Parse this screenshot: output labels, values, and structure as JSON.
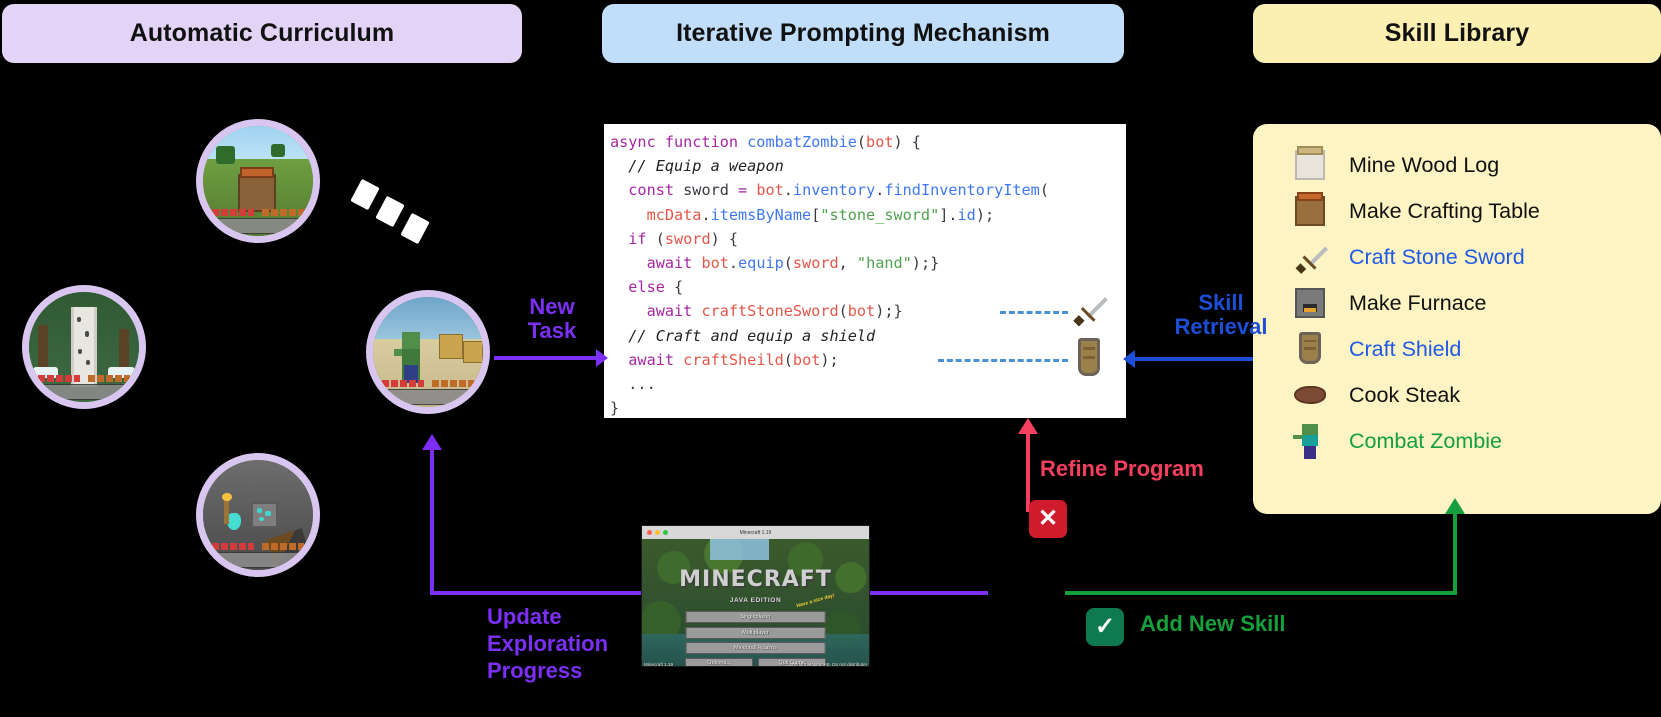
{
  "headers": {
    "curriculum": {
      "label": "Automatic Curriculum",
      "color": "#e3d4f7"
    },
    "prompting": {
      "label": "Iterative Prompting Mechanism",
      "color": "#c0ddf9"
    },
    "skill": {
      "label": "Skill Library",
      "color": "#fbf0b2"
    }
  },
  "code": {
    "lines": [
      [
        {
          "t": "async function ",
          "c": "k-kw"
        },
        {
          "t": "combatZombie",
          "c": "k-fn"
        },
        {
          "t": "(",
          "c": "k-pl"
        },
        {
          "t": "bot",
          "c": "k-var"
        },
        {
          "t": ") {",
          "c": "k-pl"
        }
      ],
      [
        {
          "t": "  // Equip a weapon",
          "c": "k-com"
        }
      ],
      [
        {
          "t": "  const",
          "c": "k-kw"
        },
        {
          "t": " sword ",
          "c": "k-pl"
        },
        {
          "t": "=",
          "c": "k-kw"
        },
        {
          "t": " bot",
          "c": "k-var"
        },
        {
          "t": ".",
          "c": "k-pl"
        },
        {
          "t": "inventory",
          "c": "k-prop"
        },
        {
          "t": ".",
          "c": "k-pl"
        },
        {
          "t": "findInventoryItem",
          "c": "k-prop"
        },
        {
          "t": "(",
          "c": "k-pl"
        }
      ],
      [
        {
          "t": "    mcData",
          "c": "k-var"
        },
        {
          "t": ".",
          "c": "k-pl"
        },
        {
          "t": "itemsByName",
          "c": "k-prop"
        },
        {
          "t": "[",
          "c": "k-pl"
        },
        {
          "t": "\"stone_sword\"",
          "c": "k-str"
        },
        {
          "t": "].",
          "c": "k-pl"
        },
        {
          "t": "id",
          "c": "k-prop"
        },
        {
          "t": ");",
          "c": "k-pl"
        }
      ],
      [
        {
          "t": "  if",
          "c": "k-kw"
        },
        {
          "t": " (",
          "c": "k-pl"
        },
        {
          "t": "sword",
          "c": "k-var"
        },
        {
          "t": ") {",
          "c": "k-pl"
        }
      ],
      [
        {
          "t": "    await",
          "c": "k-kw"
        },
        {
          "t": " bot",
          "c": "k-var"
        },
        {
          "t": ".",
          "c": "k-pl"
        },
        {
          "t": "equip",
          "c": "k-prop"
        },
        {
          "t": "(",
          "c": "k-pl"
        },
        {
          "t": "sword",
          "c": "k-var"
        },
        {
          "t": ", ",
          "c": "k-pl"
        },
        {
          "t": "\"hand\"",
          "c": "k-str"
        },
        {
          "t": ");}",
          "c": "k-pl"
        }
      ],
      [
        {
          "t": "  else",
          "c": "k-kw"
        },
        {
          "t": " {",
          "c": "k-pl"
        }
      ],
      [
        {
          "t": "    await",
          "c": "k-kw"
        },
        {
          "t": " ",
          "c": "k-pl"
        },
        {
          "t": "craftStoneSword",
          "c": "k-fn2"
        },
        {
          "t": "(",
          "c": "k-pl"
        },
        {
          "t": "bot",
          "c": "k-var"
        },
        {
          "t": ");}",
          "c": "k-pl"
        }
      ],
      [
        {
          "t": "  // Craft and equip a shield",
          "c": "k-com"
        }
      ],
      [
        {
          "t": "  await",
          "c": "k-kw"
        },
        {
          "t": " ",
          "c": "k-pl"
        },
        {
          "t": "craftSheild",
          "c": "k-fn2"
        },
        {
          "t": "(",
          "c": "k-pl"
        },
        {
          "t": "bot",
          "c": "k-var"
        },
        {
          "t": ");",
          "c": "k-pl"
        }
      ],
      [
        {
          "t": "  ...",
          "c": "k-pl"
        }
      ],
      [
        {
          "t": "}",
          "c": "k-pl"
        }
      ]
    ]
  },
  "skills": [
    {
      "icon": "wood-log-icon",
      "label": "Mine Wood  Log",
      "style": ""
    },
    {
      "icon": "crafting-table-icon",
      "label": "Make Crafting Table",
      "style": ""
    },
    {
      "icon": "stone-sword-icon",
      "label": "Craft Stone Sword",
      "style": "blue"
    },
    {
      "icon": "furnace-icon",
      "label": "Make Furnace",
      "style": ""
    },
    {
      "icon": "shield-icon",
      "label": "Craft Shield",
      "style": "blue"
    },
    {
      "icon": "steak-icon",
      "label": "Cook Steak",
      "style": ""
    },
    {
      "icon": "zombie-icon",
      "label": "Combat Zombie",
      "style": "green"
    }
  ],
  "arrows": {
    "new_task": {
      "label": "New\nTask",
      "line1": "New",
      "line2": "Task",
      "color": "#7b2ff7"
    },
    "skill_retrieval": {
      "line1": "Skill",
      "line2": "Retrieval",
      "color": "#1d4ed8"
    },
    "refine_program": {
      "label": "Refine Program",
      "color": "#f43f5e"
    },
    "add_new_skill": {
      "label": "Add New Skill",
      "color": "#15a03c"
    },
    "update_progress": {
      "line1": "Update",
      "line2": "Exploration",
      "line3": "Progress",
      "color": "#7b2ff7"
    }
  },
  "badges": {
    "error": {
      "glyph": "✕",
      "color": "#cf1b2b"
    },
    "success": {
      "glyph": "✓",
      "color": "#0f7a4f"
    }
  },
  "minecraft_window": {
    "title": "Minecraft 1.19",
    "logo": "MINECRAFT",
    "subtitle": "JAVA EDITION",
    "splash": "Have a nice day!",
    "buttons": [
      "Singleplayer",
      "Multiplayer",
      "Minecraft Realms"
    ],
    "small_buttons": [
      "Options...",
      "Quit Game"
    ],
    "version_text": "Minecraft 1.19",
    "copyright_text": "Copyright Mojang AB. Do not distribute!"
  },
  "thumbnails": [
    {
      "name": "crafting-table-scene"
    },
    {
      "name": "birch-snow-scene"
    },
    {
      "name": "zombie-village-scene"
    },
    {
      "name": "diamond-cave-scene"
    }
  ]
}
